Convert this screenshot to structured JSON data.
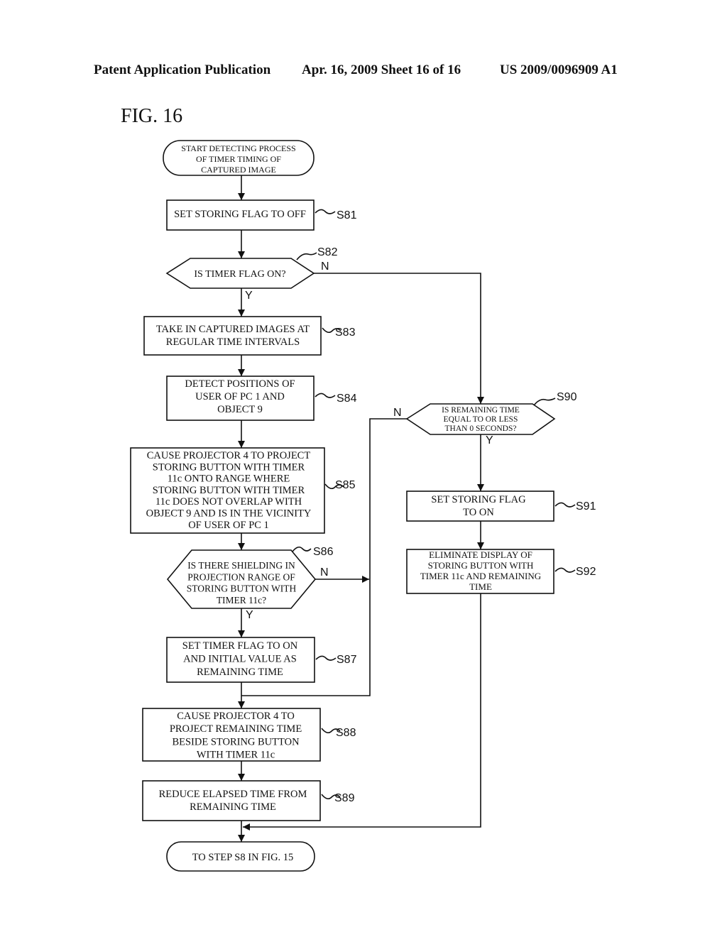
{
  "header": {
    "publication": "Patent Application Publication",
    "date_sheet": "Apr. 16, 2009  Sheet 16 of 16",
    "patent_number": "US 2009/0096909 A1"
  },
  "figure": {
    "title": "FIG. 16",
    "start": [
      "START DETECTING PROCESS",
      "OF TIMER TIMING OF",
      "CAPTURED IMAGE"
    ],
    "end": [
      "TO STEP S8 IN FIG. 15"
    ],
    "steps": {
      "S81": {
        "label": "S81",
        "lines": [
          "SET STORING FLAG TO OFF"
        ]
      },
      "S82": {
        "label": "S82",
        "lines": [
          "IS TIMER FLAG ON?"
        ],
        "yes": "Y",
        "no": "N"
      },
      "S83": {
        "label": "S83",
        "lines": [
          "TAKE IN CAPTURED IMAGES AT",
          "REGULAR TIME INTERVALS"
        ]
      },
      "S84": {
        "label": "S84",
        "lines": [
          "DETECT POSITIONS OF",
          "USER OF PC 1 AND",
          "OBJECT 9"
        ]
      },
      "S85": {
        "label": "S85",
        "lines": [
          "CAUSE PROJECTOR 4 TO PROJECT",
          "STORING BUTTON WITH TIMER",
          "11c ONTO RANGE WHERE",
          "STORING BUTTON WITH TIMER",
          "11c DOES NOT OVERLAP WITH",
          "OBJECT 9 AND IS IN THE VICINITY",
          "OF USER OF PC 1"
        ]
      },
      "S86": {
        "label": "S86",
        "lines": [
          "IS THERE SHIELDING IN",
          "PROJECTION RANGE OF",
          "STORING BUTTON WITH",
          "TIMER 11c?"
        ],
        "yes": "Y",
        "no": "N"
      },
      "S87": {
        "label": "S87",
        "lines": [
          "SET TIMER FLAG TO ON",
          "AND INITIAL VALUE AS",
          "REMAINING TIME"
        ]
      },
      "S88": {
        "label": "S88",
        "lines": [
          "CAUSE PROJECTOR 4 TO",
          "PROJECT REMAINING TIME",
          "BESIDE STORING BUTTON",
          "WITH TIMER 11c"
        ]
      },
      "S89": {
        "label": "S89",
        "lines": [
          "REDUCE ELAPSED TIME FROM",
          "REMAINING TIME"
        ]
      },
      "S90": {
        "label": "S90",
        "lines": [
          "IS REMAINING TIME",
          "EQUAL TO OR LESS",
          "THAN 0 SECONDS?"
        ],
        "yes": "Y",
        "no": "N"
      },
      "S91": {
        "label": "S91",
        "lines": [
          "SET STORING FLAG",
          "TO ON"
        ]
      },
      "S92": {
        "label": "S92",
        "lines": [
          "ELIMINATE DISPLAY OF",
          "STORING BUTTON WITH",
          "TIMER 11c AND REMAINING",
          "TIME"
        ]
      }
    }
  }
}
